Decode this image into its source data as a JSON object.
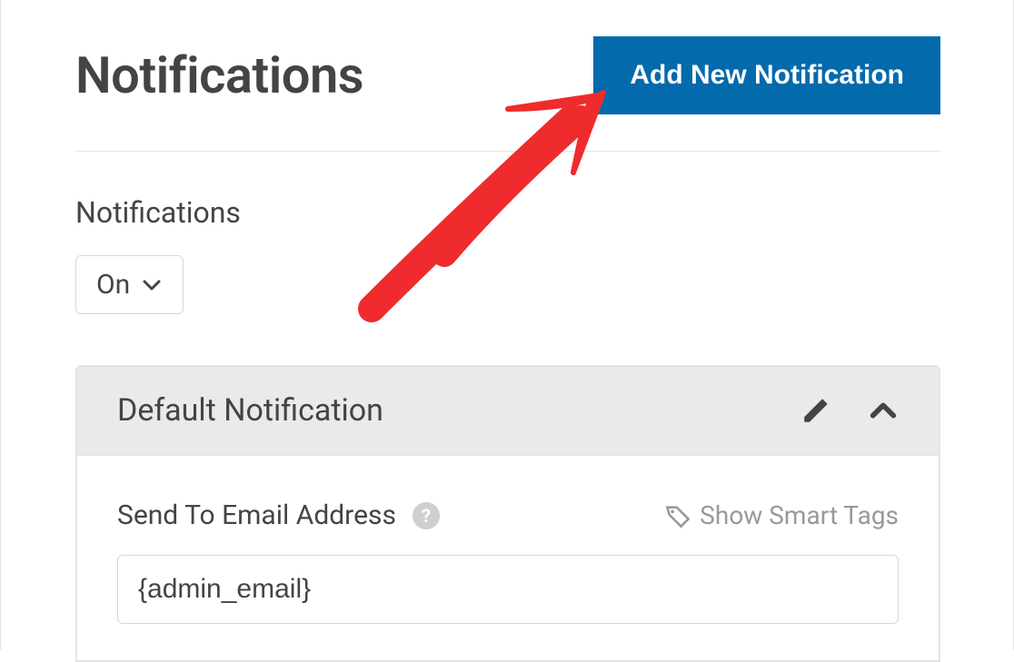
{
  "header": {
    "title": "Notifications",
    "add_button_label": "Add New Notification"
  },
  "toggle": {
    "label": "Notifications",
    "value": "On"
  },
  "card": {
    "title": "Default Notification",
    "field_label": "Send To Email Address",
    "smart_tags_label": "Show Smart Tags",
    "email_value": "{admin_email}"
  },
  "colors": {
    "primary": "#036aab",
    "annotation": "#ef2b2d"
  }
}
